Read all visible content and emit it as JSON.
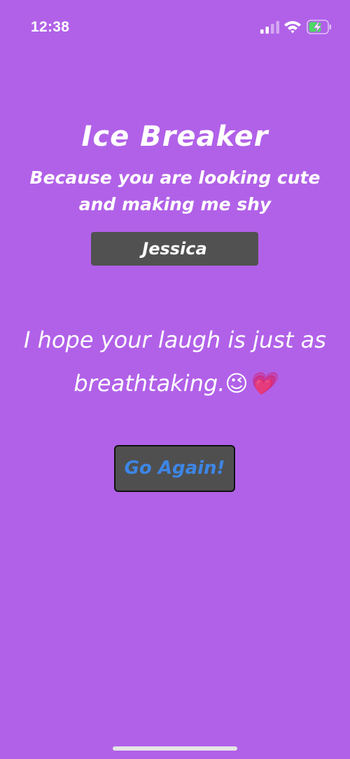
{
  "status_bar": {
    "time": "12:38",
    "icons": [
      "cellular-signal-icon",
      "wifi-icon",
      "battery-charging-icon"
    ]
  },
  "header": {
    "title": "Ice Breaker",
    "subtitle": "Because you are looking cute and making me shy"
  },
  "name": {
    "value": "Jessica"
  },
  "line": {
    "text": "I hope your laugh is just as breathtaking.😉💗"
  },
  "actions": {
    "go_again_label": "Go Again!"
  },
  "colors": {
    "background": "#b161e8",
    "badge_background": "#515151",
    "button_background": "#4f4f4f",
    "button_text": "#3d86e6",
    "text": "#ffffff"
  }
}
